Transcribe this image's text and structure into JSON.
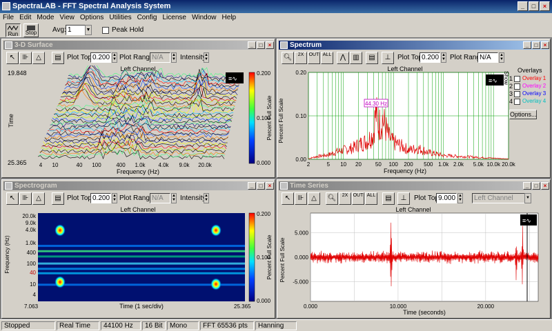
{
  "window": {
    "title": "SpectraLAB - FFT Spectral Analysis System"
  },
  "menu": [
    "File",
    "Edit",
    "Mode",
    "View",
    "Options",
    "Utilities",
    "Config",
    "License",
    "Window",
    "Help"
  ],
  "toolbar": {
    "run_label": "Run",
    "stop_label": "Stop",
    "avg_label": "Avg:",
    "avg_value": "1",
    "peak_hold_label": "Peak Hold"
  },
  "surface": {
    "title": "3-D Surface",
    "plot_top_label": "Plot Top:",
    "plot_top": "0.200",
    "plot_range_label": "Plot Range:",
    "plot_range": "N/A",
    "intensity_label": "Intensity:",
    "channel": "Left Channel",
    "ylabel": "Time",
    "y_top": "19.848",
    "y_bottom": "25.365",
    "xlabel": "Frequency (Hz)",
    "xticks": [
      "4",
      "10",
      "40",
      "100",
      "400",
      "1.0k",
      "4.0k",
      "9.0k",
      "20.0k"
    ],
    "cbar_label": "Percent Full Scale",
    "cbar_ticks": [
      "0.200",
      "0.100",
      "0.000"
    ]
  },
  "spectrum": {
    "title": "Spectrum",
    "plot_top_label": "Plot Top:",
    "plot_top": "0.200",
    "plot_range_label": "Plot Range:",
    "plot_range": "N/A",
    "channel": "Left Channel",
    "ylabel": "Percent Full Scale",
    "peak_label": "44.30 Hz",
    "overlays_label": "Overlays",
    "show_label": "Show",
    "overlays": [
      {
        "num": "1",
        "name": "Overlay 1",
        "color": "#ff0000"
      },
      {
        "num": "2",
        "name": "Overlay 2",
        "color": "#ff00ff"
      },
      {
        "num": "3",
        "name": "Overlay 3",
        "color": "#0000ff"
      },
      {
        "num": "4",
        "name": "Overlay 4",
        "color": "#00c0c0"
      }
    ],
    "options_label": "Options..."
  },
  "spectrogram": {
    "title": "Spectrogram",
    "plot_top_label": "Plot Top:",
    "plot_top": "0.200",
    "plot_range_label": "Plot Range:",
    "plot_range": "N/A",
    "intensity_label": "Intensity:",
    "channel": "Left Channel",
    "ylabel": "Frequency (Hz)",
    "yticks": [
      "20.0k",
      "9.0k",
      "4.0k",
      "1.0k",
      "400",
      "100",
      "40",
      "10",
      "4"
    ],
    "xlabel": "Time (1 sec/div)",
    "x_left": "7.063",
    "x_right": "25.365",
    "cbar_label": "Percent Full Scale",
    "cbar_ticks": [
      "0.200",
      "0.100",
      "0.000"
    ]
  },
  "timeseries": {
    "title": "Time Series",
    "plot_top_label": "Plot Top:",
    "plot_top": "9.000",
    "channel_select": "Left Channel",
    "channel": "Left Channel",
    "ylabel": "Percent Full Scale",
    "xlabel": "Time (seconds)"
  },
  "status": [
    "Stopped",
    "Real Time",
    "44100 Hz",
    "16 Bit",
    "Mono",
    "FFT 65536 pts",
    "Hanning"
  ],
  "chart_data": [
    {
      "type": "line",
      "title": "",
      "panel": "Spectrum",
      "xlabel": "Frequency (Hz)",
      "ylabel": "Percent Full Scale",
      "x_scale": "log",
      "xticks": [
        "2",
        "5",
        "10",
        "20",
        "50",
        "100",
        "200",
        "500",
        "1.0k",
        "2.0k",
        "5.0k",
        "10.0k",
        "20.0k"
      ],
      "ylim": [
        0,
        0.2
      ],
      "yticks": [
        "0.20",
        "0.10",
        "0.00"
      ],
      "x": [
        2,
        3,
        5,
        7,
        10,
        15,
        20,
        30,
        40,
        44.3,
        50,
        60,
        80,
        100,
        150,
        200,
        300,
        500,
        700,
        1000,
        2000,
        5000,
        10000,
        20000
      ],
      "y": [
        0.002,
        0.008,
        0.012,
        0.02,
        0.025,
        0.03,
        0.04,
        0.05,
        0.07,
        0.13,
        0.09,
        0.11,
        0.06,
        0.045,
        0.035,
        0.025,
        0.03,
        0.018,
        0.015,
        0.01,
        0.008,
        0.005,
        0.003,
        0.001
      ],
      "grid": true
    },
    {
      "type": "line",
      "title": "",
      "panel": "Time Series",
      "xlabel": "Time (seconds)",
      "ylabel": "Percent Full Scale",
      "xticks": [
        "0.000",
        "10.000",
        "20.000"
      ],
      "yticks": [
        "5.000",
        "0.000",
        "-5.000"
      ],
      "xlim": [
        0,
        26
      ],
      "ylim": [
        -9,
        9
      ],
      "spikes": [
        {
          "x": 9.2,
          "y": 8.5
        },
        {
          "x": 23.5,
          "y": 5.5
        },
        {
          "x": 24.2,
          "y": -8
        }
      ],
      "grid": true
    }
  ]
}
